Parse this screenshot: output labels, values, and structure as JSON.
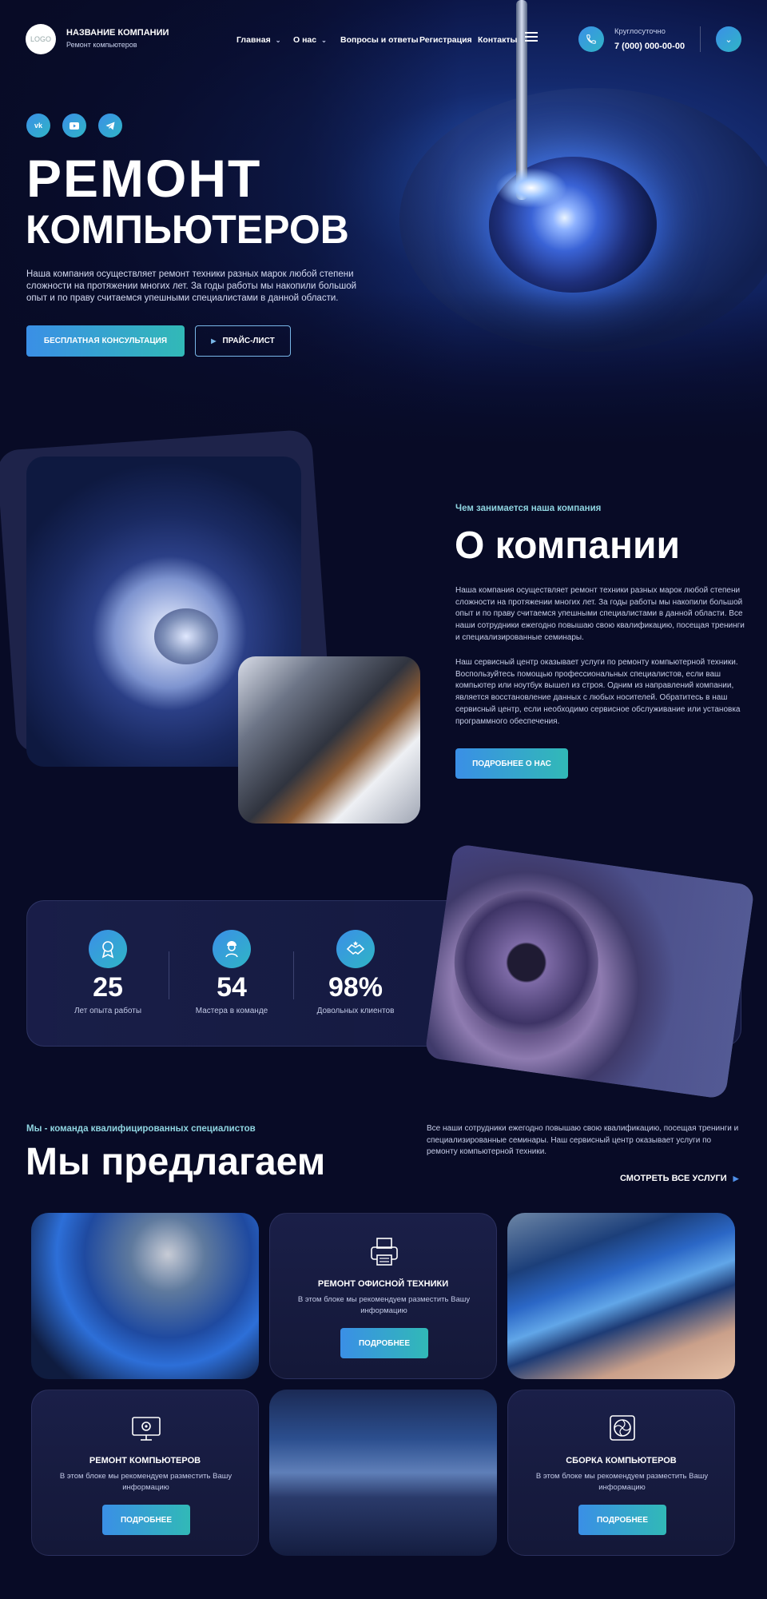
{
  "header": {
    "logo_text": "LOGO",
    "company_name": "НАЗВАНИЕ КОМПАНИИ",
    "company_sub": "Ремонт компьютеров",
    "nav": [
      {
        "label": "Главная",
        "has_dropdown": true
      },
      {
        "label": "О нас",
        "has_dropdown": true
      },
      {
        "label": "Вопросы и ответы",
        "has_dropdown": false
      },
      {
        "label": "Регистрация",
        "has_dropdown": false
      },
      {
        "label": "Контакты",
        "has_dropdown": false
      }
    ],
    "phone_label": "Круглосуточно",
    "phone_number": "7 (000) 000-00-00"
  },
  "social": [
    "vk",
    "youtube",
    "telegram"
  ],
  "hero": {
    "title_line1": "РЕМОНТ",
    "title_line2": "КОМПЬЮТЕРОВ",
    "text": "Наша компания осуществляет ремонт техники разных марок любой степени сложности на протяжении многих лет. За годы работы мы накопили большой опыт и по праву считаемся упешными специалистами в данной области.",
    "btn_primary": "БЕСПЛАТНАЯ КОНСУЛЬТАЦИЯ",
    "btn_secondary": "ПРАЙС-ЛИСТ"
  },
  "about": {
    "tag": "Чем занимается наша компания",
    "title": "О компании",
    "p1": "Наша компания осуществляет ремонт техники разных марок любой степени сложности на протяжении многих лет. За годы работы мы накопили большой опыт и по праву считаемся упешными специалистами в данной области. Все наши сотрудники ежегодно повышаю свою квалификацию, посещая тренинги и специализированные семинары.",
    "p2": "Наш сервисный центр оказывает услуги по ремонту компьютерной техники. Воспользуйтесь помощью профессиональных специалистов, если ваш компьютер или ноутбук вышел из строя. Одним из направлений компании, является восстановление данных с любых носителей. Обратитесь в наш сервисный центр, если необходимо сервисное обслуживание или установка программного обеспечения.",
    "button": "ПОДРОБНЕЕ О НАС"
  },
  "stats": [
    {
      "value": "25",
      "label": "Лет опыта работы",
      "icon": "award-icon"
    },
    {
      "value": "54",
      "label": "Мастера в команде",
      "icon": "worker-icon"
    },
    {
      "value": "98%",
      "label": "Довольных клиентов",
      "icon": "handshake-icon"
    }
  ],
  "services": {
    "tag": "Мы - команда квалифицированных специалистов",
    "title": "Мы предлагаем",
    "text": "Все наши сотрудники ежегодно повышаю свою квалификацию, посещая тренинги и специализированные семинары. Наш сервисный центр оказывает услуги по ремонту компьютерной техники.",
    "view_all": "СМОТРЕТЬ ВСЕ УСЛУГИ",
    "cards": [
      {
        "title": "РЕМОНТ ОФИСНОЙ ТЕХНИКИ",
        "desc": "В этом блоке мы рекомендуем разместить Вашу информацию",
        "button": "ПОДРОБНЕЕ",
        "icon": "printer-icon"
      },
      {
        "title": "РЕМОНТ КОМПЬЮТЕРОВ",
        "desc": "В этом блоке мы рекомендуем разместить Вашу информацию",
        "button": "ПОДРОБНЕЕ",
        "icon": "monitor-gear-icon"
      },
      {
        "title": "СБОРКА КОМПЬЮТЕРОВ",
        "desc": "В этом блоке мы рекомендуем разместить Вашу информацию",
        "button": "ПОДРОБНЕЕ",
        "icon": "cpu-fan-icon"
      }
    ]
  }
}
